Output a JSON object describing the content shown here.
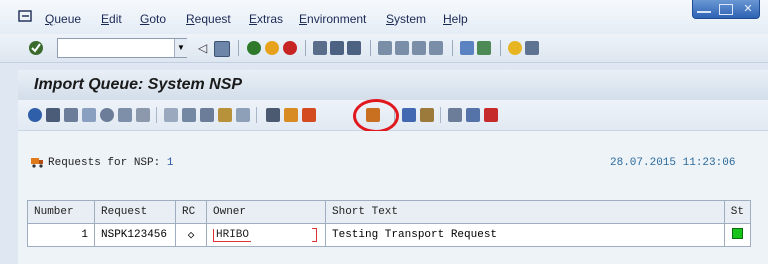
{
  "menubar": {
    "items": [
      "Queue",
      "Edit",
      "Goto",
      "Request",
      "Extras",
      "Environment",
      "System",
      "Help"
    ]
  },
  "command_field": {
    "value": ""
  },
  "screen": {
    "title": "Import Queue: System NSP",
    "requests_label": "Requests for NSP:",
    "requests_count": "1",
    "timestamp": "28.07.2015 11:23:06"
  },
  "table": {
    "columns": [
      "Number",
      "Request",
      "RC",
      "Owner",
      "Short Text",
      "St"
    ],
    "rows": [
      {
        "number": "1",
        "request": "NSPK123456",
        "rc": "◇",
        "owner": "HRIBO",
        "short_text": "Testing Transport Request",
        "status": "green"
      }
    ]
  },
  "colors": {
    "highlight": "#e0191e",
    "status_ok": "#18c41a"
  }
}
